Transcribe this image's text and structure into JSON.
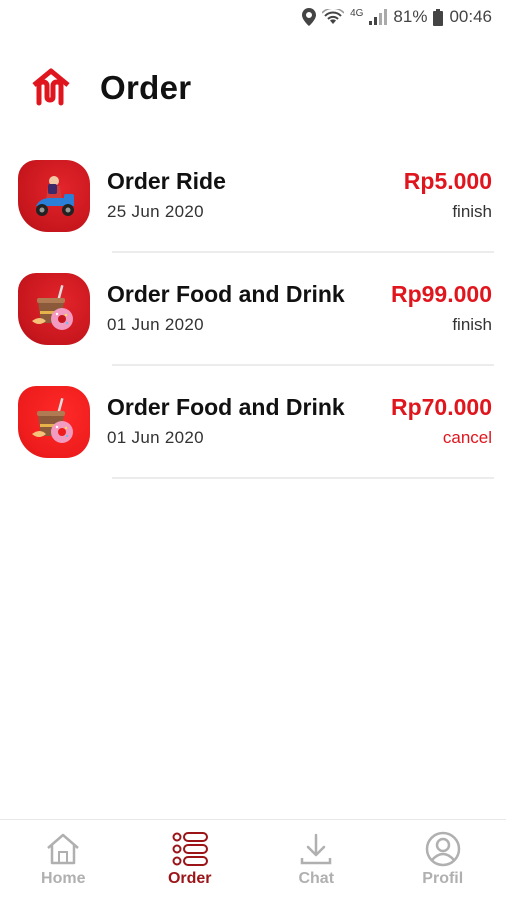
{
  "status_bar": {
    "battery": "81%",
    "time": "00:46",
    "network": "4G"
  },
  "header": {
    "title": "Order",
    "logo_icon": "app-logo-icon"
  },
  "colors": {
    "accent": "#e0161e",
    "nav_active": "#9a1418",
    "nav_inactive": "#b0b0b0"
  },
  "orders": [
    {
      "name": "Order Ride",
      "date": "25 Jun 2020",
      "price": "Rp5.000",
      "status": "finish",
      "icon": "scooter-ride-icon"
    },
    {
      "name": "Order Food and Drink",
      "date": "01 Jun 2020",
      "price": "Rp99.000",
      "status": "finish",
      "icon": "food-drink-icon"
    },
    {
      "name": "Order Food and Drink",
      "date": "01 Jun 2020",
      "price": "Rp70.000",
      "status": "cancel",
      "icon": "food-drink-icon"
    }
  ],
  "nav": {
    "items": [
      {
        "label": "Home",
        "icon": "home-icon"
      },
      {
        "label": "Order",
        "icon": "order-list-icon",
        "active": true
      },
      {
        "label": "Chat",
        "icon": "download-icon"
      },
      {
        "label": "Profil",
        "icon": "profile-icon"
      }
    ]
  }
}
